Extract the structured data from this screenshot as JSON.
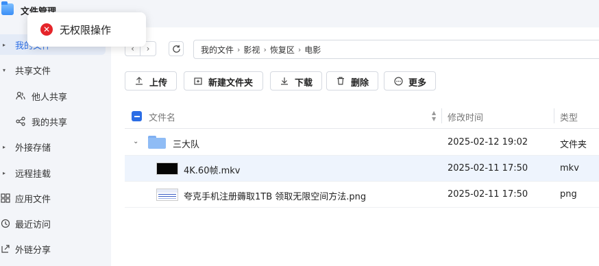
{
  "app": {
    "title": "文件管理"
  },
  "toast": {
    "message": "无权限操作"
  },
  "sidebar": {
    "items": [
      {
        "label": "我的文件",
        "icon": "arrow"
      },
      {
        "label": "共享文件",
        "icon": "arrow"
      },
      {
        "label": "他人共享",
        "icon": "people-icon"
      },
      {
        "label": "我的共享",
        "icon": "share-icon"
      },
      {
        "label": "外接存储",
        "icon": "arrow"
      },
      {
        "label": "远程挂载",
        "icon": "arrow"
      },
      {
        "label": "应用文件",
        "icon": "grid-icon"
      },
      {
        "label": "最近访问",
        "icon": "clock-icon"
      },
      {
        "label": "外链分享",
        "icon": "link-icon"
      }
    ]
  },
  "breadcrumb": [
    "我的文件",
    "影视",
    "恢复区",
    "电影"
  ],
  "toolbar": {
    "upload": "上传",
    "new_folder": "新建文件夹",
    "download": "下载",
    "delete": "删除",
    "more": "更多"
  },
  "table": {
    "headers": {
      "name": "文件名",
      "modified": "修改时间",
      "type": "类型"
    },
    "rows": [
      {
        "name": "三大队",
        "modified": "2025-02-12 19:02",
        "type": "文件夹"
      },
      {
        "name": "4K.60帧.mkv",
        "modified": "2025-02-11 17:50",
        "type": "mkv"
      },
      {
        "name": "夸克手机注册薅取1TB 领取无限空间方法.png",
        "modified": "2025-02-11 17:50",
        "type": "png"
      }
    ]
  },
  "colors": {
    "accent": "#2b6de5",
    "error": "#e5252a",
    "folder": "#8fbcf5"
  }
}
